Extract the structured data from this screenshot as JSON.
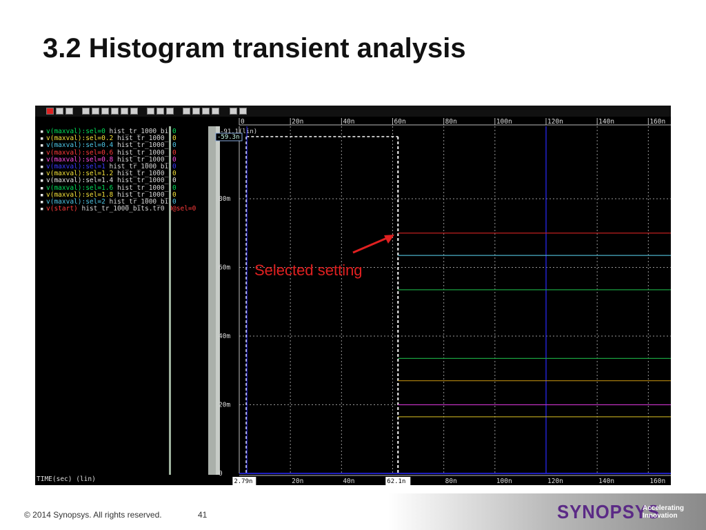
{
  "slide": {
    "title": "3.2 Histogram transient analysis",
    "annotation": "Selected setting",
    "copyright": "© 2014 Synopsys. All rights reserved.",
    "page_number": "41",
    "logo_text": "SYNOPSYS",
    "tagline_line1": "Accelerating",
    "tagline_line2": "Innovation"
  },
  "waveform": {
    "signals": [
      {
        "name": "v(maxval):sel=0",
        "file": "hist_tr_1000_bi",
        "val": "0",
        "color": "#00e05a"
      },
      {
        "name": "v(maxval):sel=0.2",
        "file": "hist_tr_1000_",
        "val": "0",
        "color": "#f5e33a"
      },
      {
        "name": "v(maxval):sel=0.4",
        "file": "hist_tr_1000_",
        "val": "0",
        "color": "#4ec8e8"
      },
      {
        "name": "v(maxval):sel=0.6",
        "file": "hist_tr_1000_",
        "val": "0",
        "color": "#ff3b3b"
      },
      {
        "name": "v(maxval):sel=0.8",
        "file": "hist_tr_1000_",
        "val": "0",
        "color": "#ff4de1"
      },
      {
        "name": "v(maxval):sel=1",
        "file": "hist_tr_1000_bi",
        "val": "0",
        "color": "#3a3aff"
      },
      {
        "name": "v(maxval):sel=1.2",
        "file": "hist_tr_1000_",
        "val": "0",
        "color": "#f5e33a"
      },
      {
        "name": "v(maxval):sel=1.4",
        "file": "hist_tr_1000_",
        "val": "0",
        "color": "#e8e8e8"
      },
      {
        "name": "v(maxval):sel=1.6",
        "file": "hist_tr_1000_",
        "val": "0",
        "color": "#00e05a"
      },
      {
        "name": "v(maxval):sel=1.8",
        "file": "hist_tr_1000_",
        "val": "0",
        "color": "#f5e33a"
      },
      {
        "name": "v(maxval):sel=2",
        "file": "hist_tr_1000_bi",
        "val": "0",
        "color": "#4ec8e8"
      },
      {
        "name": "v(start)",
        "file": "hist_tr_1000_bits.tr0",
        "val": "0@sel=0",
        "color": "#ff3b3b"
      }
    ],
    "x_ticks": [
      "0",
      "20n",
      "40n",
      "60n",
      "80n",
      "100n",
      "120n",
      "140n",
      "160n"
    ],
    "y_ticks": [
      "0",
      "20m",
      "40m",
      "60m",
      "80m"
    ],
    "y_top_label": "-91.1(lin)",
    "cursor_value": "-59.3n",
    "x_axis_label": "TIME(sec) (lin)",
    "cursor1_label": "2.79n",
    "cursor2_label": "62.1n",
    "levels": [
      {
        "value_m": 70,
        "color": "#c02020"
      },
      {
        "value_m": 63.5,
        "color": "#4ab0c8"
      },
      {
        "value_m": 53.5,
        "color": "#1aa040"
      },
      {
        "value_m": 33.5,
        "color": "#1aa040"
      },
      {
        "value_m": 27,
        "color": "#b88a10"
      },
      {
        "value_m": 20,
        "color": "#c030c0"
      },
      {
        "value_m": 16.5,
        "color": "#c8b020"
      }
    ]
  }
}
